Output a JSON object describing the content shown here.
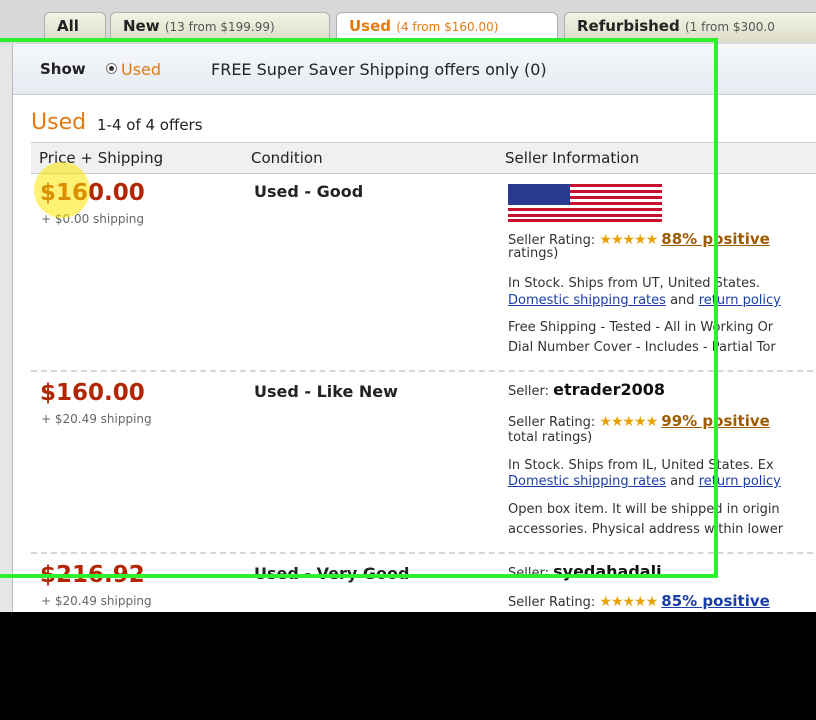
{
  "tabs": [
    {
      "label": "All",
      "detail": ""
    },
    {
      "label": "New",
      "detail": "(13 from $199.99)"
    },
    {
      "label": "Used",
      "detail": "(4 from $160.00)"
    },
    {
      "label": "Refurbished",
      "detail": "(1 from $300.0"
    }
  ],
  "filter": {
    "show_label": "Show",
    "used_option": "Used",
    "free_shipping_text": "FREE Super Saver Shipping offers only (0)"
  },
  "section": {
    "title": "Used",
    "count": "1-4 of 4 offers"
  },
  "columns": {
    "price": "Price + Shipping",
    "condition": "Condition",
    "seller": "Seller Information"
  },
  "offers": [
    {
      "price": "$160.00",
      "shipping": "+ $0.00 shipping",
      "condition": "Used - Good",
      "seller_name": "",
      "rating_label": "Seller Rating:",
      "rating_positive": "88% positive",
      "rating_tail": "ratings)",
      "stock": "In Stock. Ships from UT, United States.",
      "domestic_link": "Domestic shipping rates",
      "and_text": "and",
      "return_link": "return policy",
      "comment1": "Free Shipping - Tested - All in Working Or",
      "comment2": "Dial Number Cover - Includes - Partial Tor"
    },
    {
      "price": "$160.00",
      "shipping": "+ $20.49 shipping",
      "condition": "Used - Like New",
      "seller_label": "Seller:",
      "seller_name": "etrader2008",
      "rating_label": "Seller Rating:",
      "rating_positive": "99% positive",
      "rating_tail": "total ratings)",
      "stock": "In Stock. Ships from IL, United States. Ex",
      "domestic_link": "Domestic shipping rates",
      "and_text": "and",
      "return_link": "return policy",
      "comment1": "Open box item. It will be shipped in origin",
      "comment2": "accessories. Physical address within lower"
    },
    {
      "price": "$216.92",
      "shipping": "+ $20.49 shipping",
      "condition": "Used - Very Good",
      "seller_label": "Seller:",
      "seller_name": "syedahadali",
      "rating_label": "Seller Rating:",
      "rating_positive": "85% positive"
    }
  ],
  "colors": {
    "accent_orange": "#e47911",
    "price_red": "#b12704",
    "link_blue": "#1a3ea8",
    "highlight_green": "#2cf12c"
  },
  "icons": {
    "stars": "rating-stars-icon",
    "flag": "us-flag-icon"
  }
}
